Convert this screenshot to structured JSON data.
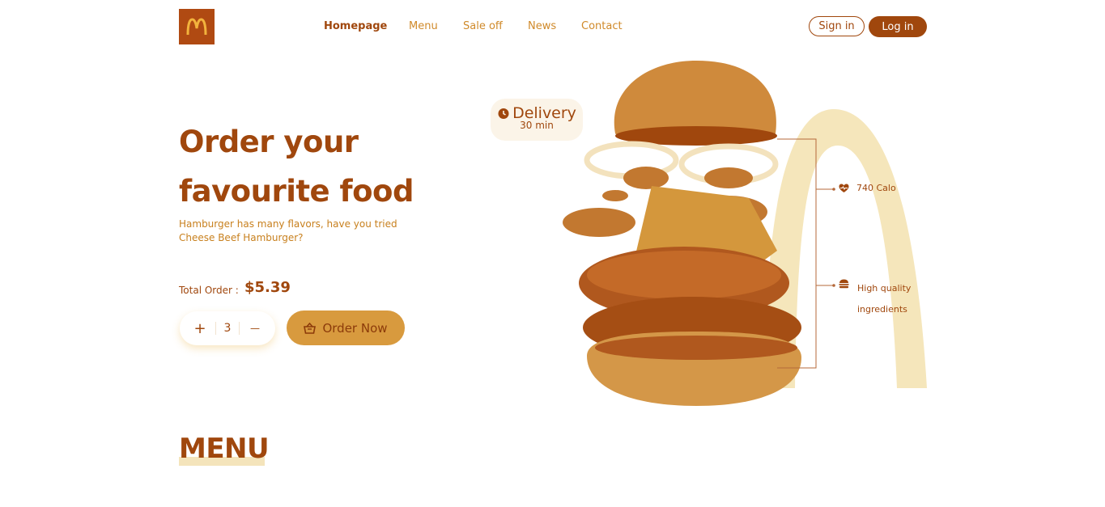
{
  "header": {
    "logo_letter": "M",
    "nav": [
      {
        "label": "Homepage",
        "active": true
      },
      {
        "label": "Menu",
        "active": false
      },
      {
        "label": "Sale off",
        "active": false
      },
      {
        "label": "News",
        "active": false
      },
      {
        "label": "Contact",
        "active": false
      }
    ],
    "sign_in_label": "Sign in",
    "log_in_label": "Log in"
  },
  "hero": {
    "title_line1": "Order your",
    "title_line2": "favourite food",
    "subtitle_line1": "Hamburger has many flavors, have you tried",
    "subtitle_line2": "Cheese Beef Hamburger?",
    "total_label": "Total Order :",
    "total_value": "$5.39",
    "quantity": "3",
    "plus_symbol": "+",
    "minus_symbol": "—",
    "order_button_label": "Order Now"
  },
  "delivery": {
    "title": "Delivery",
    "time": "30 min"
  },
  "annotations": {
    "calories": "740 Calo",
    "quality_line1": "High quality",
    "quality_line2": "ingredients"
  },
  "menu_section": {
    "heading": "MENU"
  },
  "colors": {
    "brand_dark": "#a0470d",
    "brand_mid": "#d89a3e",
    "brand_light": "#f4e4bb",
    "accent_text": "#c8801e"
  },
  "icons": {
    "logo": "golden-arches-icon",
    "order": "basket-icon",
    "delivery": "clock-icon",
    "calories": "heart-monitor-icon",
    "quality": "burger-icon"
  }
}
